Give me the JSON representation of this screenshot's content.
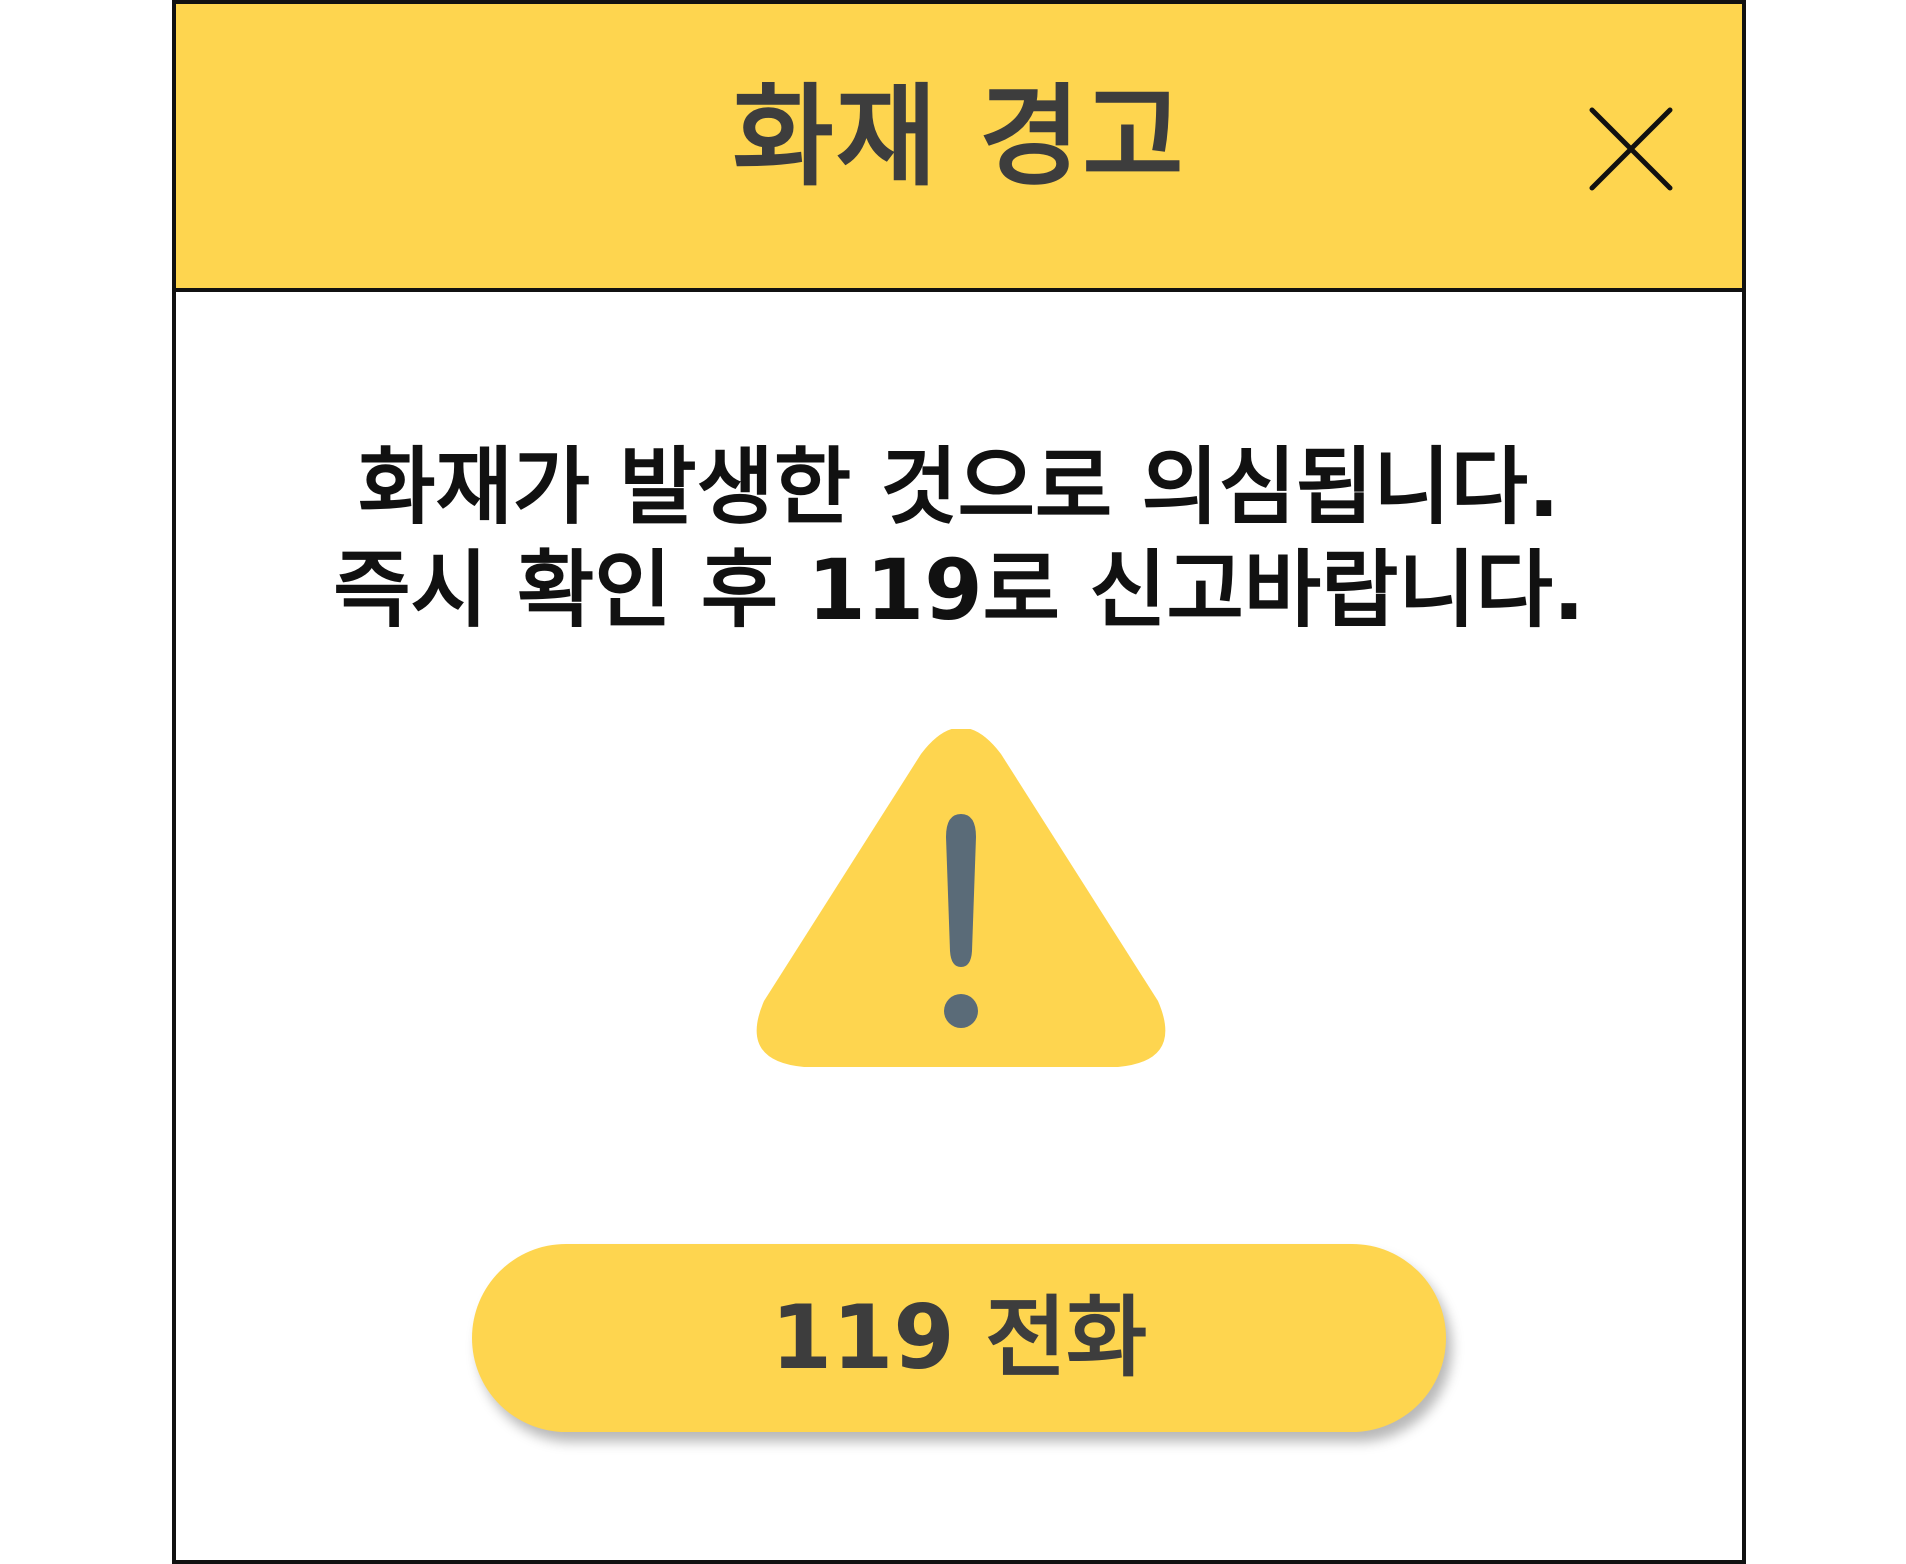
{
  "dialog": {
    "title": "화재 경고",
    "message_lines": [
      "화재가 발생한 것으로 의심됩니다.",
      "즉시 확인 후 119로 신고바랍니다."
    ],
    "call_button_label": "119 전화",
    "icons": {
      "close": "close-icon",
      "warning": "warning-triangle-icon"
    }
  },
  "colors": {
    "accent": "#FED54F",
    "title_text": "#3d3d3d",
    "body_text": "#111111",
    "border": "#111111",
    "exclamation": "#5A6B78"
  }
}
